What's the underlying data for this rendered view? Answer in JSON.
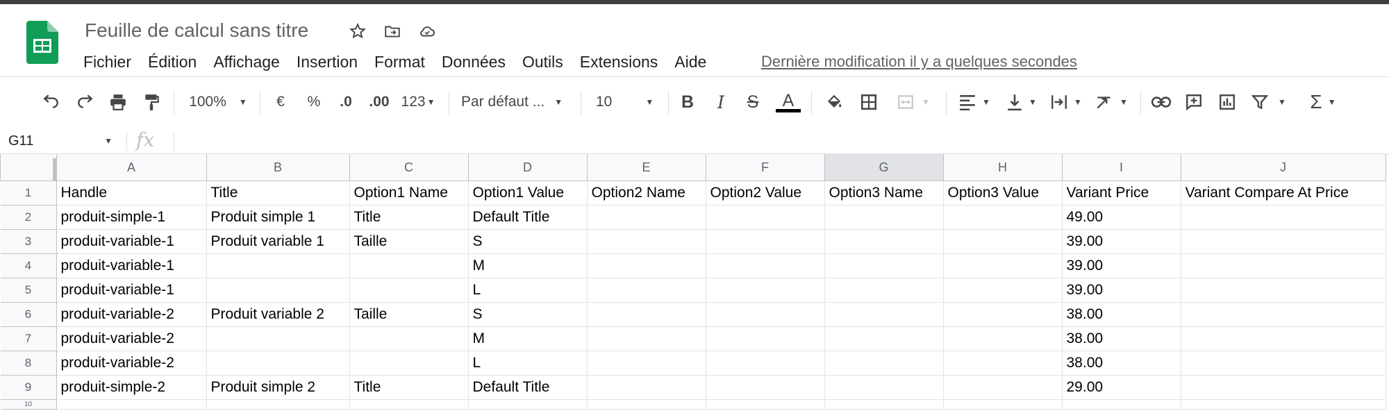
{
  "doc": {
    "title": "Feuille de calcul sans titre"
  },
  "menu": {
    "items": [
      "Fichier",
      "Édition",
      "Affichage",
      "Insertion",
      "Format",
      "Données",
      "Outils",
      "Extensions",
      "Aide"
    ],
    "last_edit": "Dernière modification il y a quelques secondes"
  },
  "toolbar": {
    "zoom": "100%",
    "currency": "€",
    "percent": "%",
    "dec_less": ".0",
    "dec_more": ".00",
    "more_formats": "123",
    "font": "Par défaut ...",
    "font_size": "10",
    "bold": "B",
    "italic": "I",
    "strike": "S",
    "text_color": "A",
    "text_color_value": "#000000"
  },
  "formula_bar": {
    "cell_ref": "G11",
    "fx": "fx",
    "value": ""
  },
  "grid": {
    "columns": [
      "A",
      "B",
      "C",
      "D",
      "E",
      "F",
      "G",
      "H",
      "I",
      "J"
    ],
    "selected_column": "G",
    "rows": [
      {
        "n": "1",
        "cells": [
          "Handle",
          "Title",
          "Option1 Name",
          "Option1 Value",
          "Option2 Name",
          "Option2 Value",
          "Option3 Name",
          "Option3 Value",
          "Variant Price",
          "Variant Compare At Price"
        ]
      },
      {
        "n": "2",
        "cells": [
          "produit-simple-1",
          "Produit simple 1",
          "Title",
          "Default Title",
          "",
          "",
          "",
          "",
          "49.00",
          ""
        ]
      },
      {
        "n": "3",
        "cells": [
          "produit-variable-1",
          "Produit variable 1",
          "Taille",
          "S",
          "",
          "",
          "",
          "",
          "39.00",
          ""
        ]
      },
      {
        "n": "4",
        "cells": [
          "produit-variable-1",
          "",
          "",
          "M",
          "",
          "",
          "",
          "",
          "39.00",
          ""
        ]
      },
      {
        "n": "5",
        "cells": [
          "produit-variable-1",
          "",
          "",
          "L",
          "",
          "",
          "",
          "",
          "39.00",
          ""
        ]
      },
      {
        "n": "6",
        "cells": [
          "produit-variable-2",
          "Produit variable 2",
          "Taille",
          "S",
          "",
          "",
          "",
          "",
          "38.00",
          ""
        ]
      },
      {
        "n": "7",
        "cells": [
          "produit-variable-2",
          "",
          "",
          "M",
          "",
          "",
          "",
          "",
          "38.00",
          ""
        ]
      },
      {
        "n": "8",
        "cells": [
          "produit-variable-2",
          "",
          "",
          "L",
          "",
          "",
          "",
          "",
          "38.00",
          ""
        ]
      },
      {
        "n": "9",
        "cells": [
          "produit-simple-2",
          "Produit simple 2",
          "Title",
          "Default Title",
          "",
          "",
          "",
          "",
          "29.00",
          ""
        ]
      },
      {
        "n": "10",
        "cells": [
          "",
          "",
          "",
          "",
          "",
          "",
          "",
          "",
          "",
          ""
        ]
      }
    ]
  },
  "colors": {
    "sheets_green": "#0f9d58",
    "selected_header": "#e1e3e6"
  }
}
